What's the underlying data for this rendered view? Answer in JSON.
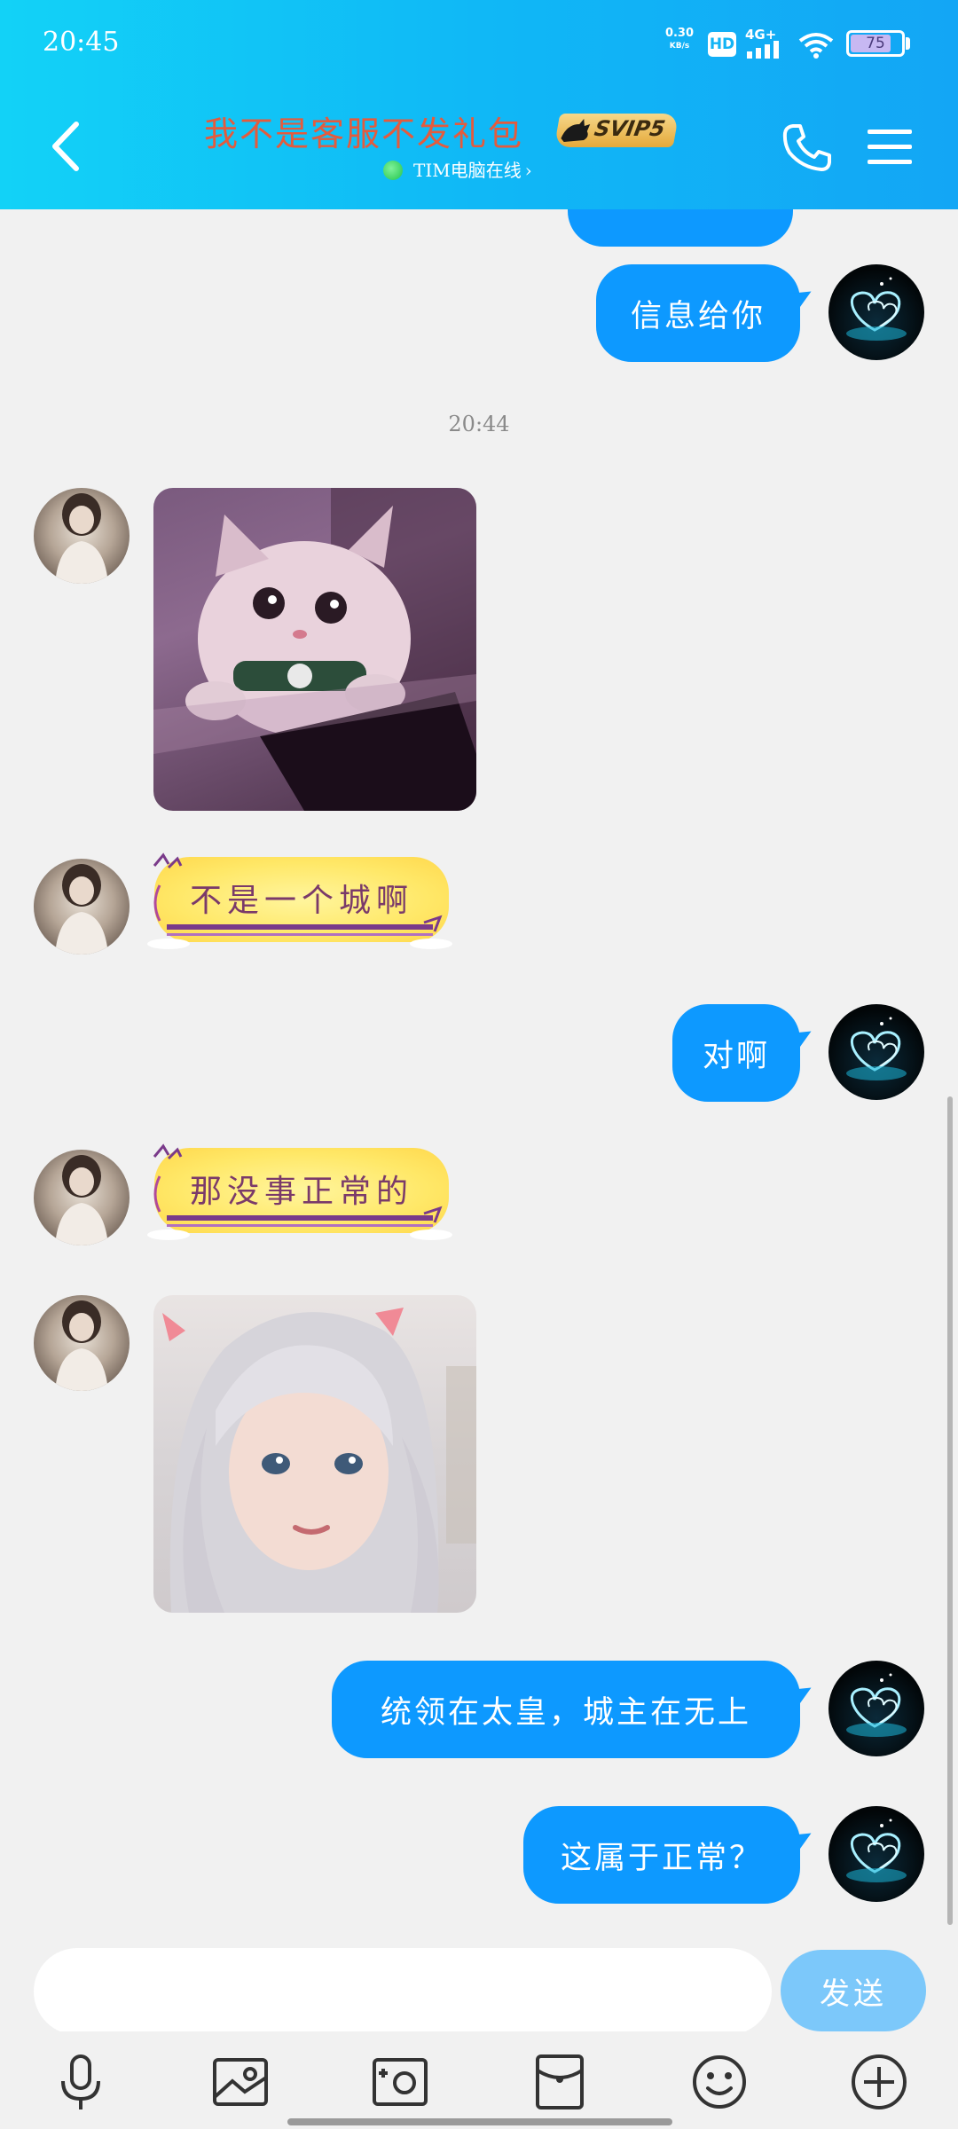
{
  "status_bar": {
    "time": "20:45",
    "net_speed": "0.30",
    "net_speed_unit": "KB/s",
    "hd": "HD",
    "network": "4G+",
    "battery": "75"
  },
  "header": {
    "title": "我不是客服不发礼包",
    "vip_badge": "SVIP5",
    "online_status": "TIM电脑在线",
    "online_chevron": "›"
  },
  "messages": {
    "msg1": "信息给你",
    "timestamp": "20:44",
    "msg3": "不是一个城啊",
    "msg4": "对啊",
    "msg5": "那没事正常的",
    "msg7": "统领在太皇，城主在无上",
    "msg8": "这属于正常？"
  },
  "input": {
    "placeholder": "",
    "send_label": "发送"
  },
  "icons": {
    "back": "chevron-left-icon",
    "call": "phone-icon",
    "menu": "menu-icon",
    "voice": "microphone-icon",
    "image": "image-icon",
    "camera": "camera-icon",
    "red_packet": "red-packet-icon",
    "emoji": "emoji-icon",
    "more": "plus-icon"
  },
  "colors": {
    "header_start": "#12d2f7",
    "header_end": "#13a6f5",
    "outgoing_bubble": "#0d99ff",
    "title": "#e45b3d",
    "send_button": "#7cc8fa"
  }
}
